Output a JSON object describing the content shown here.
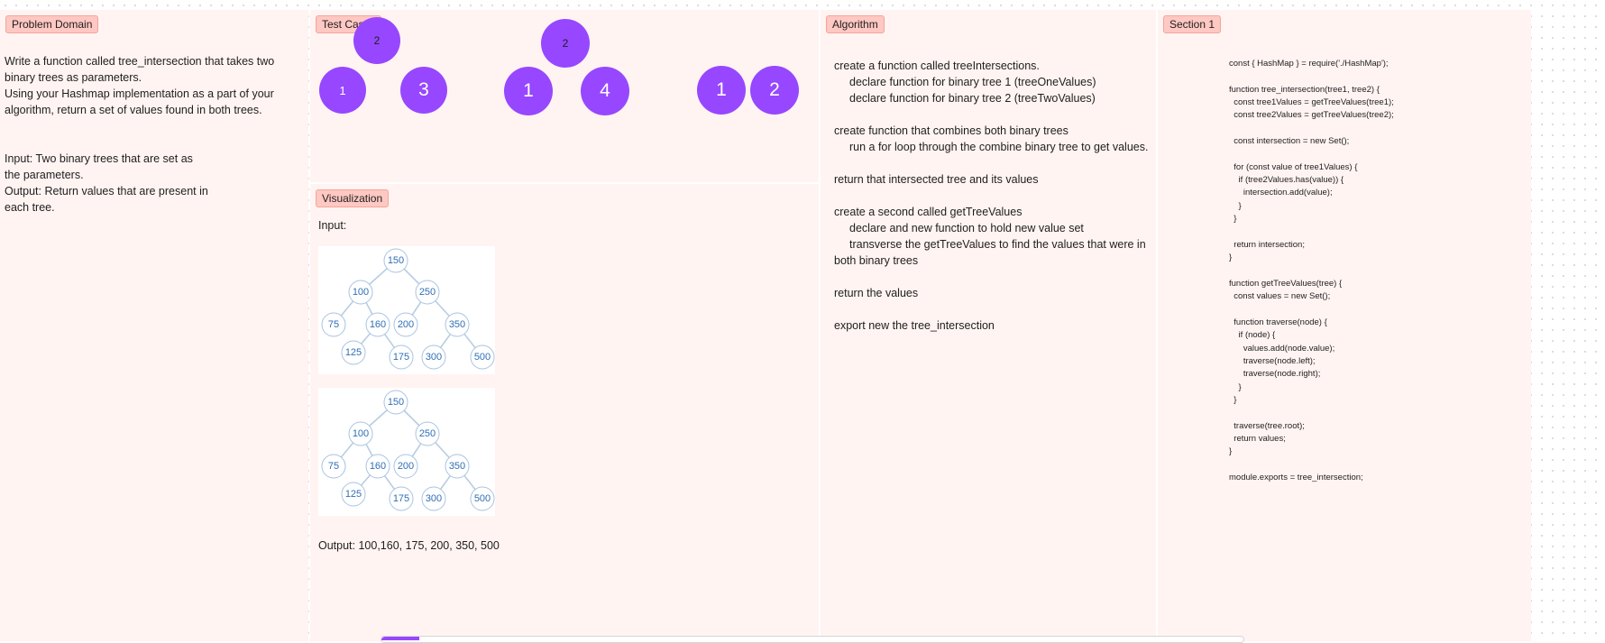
{
  "sections": {
    "problem_domain": "Problem Domain",
    "test_cases": "Test Cases",
    "visualization": "Visualization",
    "algorithm": "Algorithm",
    "code_section": "Section 1"
  },
  "problem": {
    "description_lines": [
      "Write a function called tree_intersection that takes two",
      "binary trees as parameters.",
      "Using your Hashmap implementation as a part of your",
      "algorithm, return a set of values found in both trees."
    ],
    "io_lines": [
      "Input: Two binary trees that are set as",
      "the parameters.",
      "Output: Return values that are present in",
      "each tree."
    ]
  },
  "test_cases": {
    "circles": [
      "2",
      "1",
      "3",
      "2",
      "1",
      "4",
      "1",
      "2"
    ],
    "circle_color": "#9747ff"
  },
  "visualization": {
    "input_label": "Input:",
    "output_label": "Output: 100,160, 175, 200, 350, 500",
    "tree_nodes": [
      "150",
      "100",
      "250",
      "75",
      "160",
      "200",
      "350",
      "125",
      "175",
      "300",
      "500"
    ],
    "node_color": "#2f6fb5"
  },
  "algorithm": {
    "lines": [
      "create a function called treeIntersections.",
      "declare function for binary tree 1 (treeOneValues)",
      "declare function for binary tree 2 (treeTwoValues)",
      "create function that combines both binary trees",
      "run a for loop through the combine binary tree to get values.",
      "return that intersected tree and its values",
      "create a second called getTreeValues",
      "declare and new function to hold new value set",
      "transverse the getTreeValues to find the values that were in",
      "both binary trees",
      "return the values",
      "export new the tree_intersection"
    ]
  },
  "code": {
    "text": "const { HashMap } = require('./HashMap');\n\nfunction tree_intersection(tree1, tree2) {\n  const tree1Values = getTreeValues(tree1);\n  const tree2Values = getTreeValues(tree2);\n\n  const intersection = new Set();\n\n  for (const value of tree1Values) {\n    if (tree2Values.has(value)) {\n      intersection.add(value);\n    }\n  }\n\n  return intersection;\n}\n\nfunction getTreeValues(tree) {\n  const values = new Set();\n\n  function traverse(node) {\n    if (node) {\n      values.add(node.value);\n      traverse(node.left);\n      traverse(node.right);\n    }\n  }\n\n  traverse(tree.root);\n  return values;\n}\n\nmodule.exports = tree_intersection;"
  },
  "colors": {
    "section_bg": "#fff4f2",
    "label_bg": "#ffc8c2",
    "accent_purple": "#9747ff"
  }
}
